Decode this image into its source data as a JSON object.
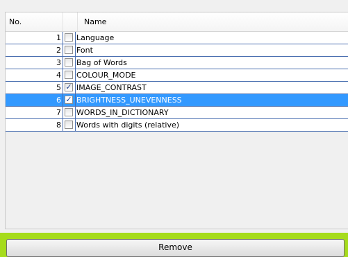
{
  "table": {
    "columns": {
      "no": "No.",
      "name": "Name"
    },
    "rows": [
      {
        "no": "1",
        "checked": "",
        "name": "Language",
        "selected": false
      },
      {
        "no": "2",
        "checked": "",
        "name": "Font",
        "selected": false
      },
      {
        "no": "3",
        "checked": "",
        "name": "Bag of Words",
        "selected": false
      },
      {
        "no": "4",
        "checked": "",
        "name": "COLOUR_MODE",
        "selected": false
      },
      {
        "no": "5",
        "checked": "✓",
        "name": "IMAGE_CONTRAST",
        "selected": false
      },
      {
        "no": "6",
        "checked": "✓",
        "name": "BRIGHTNESS_UNEVENNESS",
        "selected": true
      },
      {
        "no": "7",
        "checked": "",
        "name": "WORDS_IN_DICTIONARY",
        "selected": false
      },
      {
        "no": "8",
        "checked": "",
        "name": "Words with digits (relative)",
        "selected": false
      }
    ]
  },
  "actions": {
    "remove_label": "Remove"
  },
  "colors": {
    "selection": "#3399ff",
    "footer_accent": "#a6dc1c"
  },
  "icons": {
    "checkbox_checked": "check-icon"
  }
}
